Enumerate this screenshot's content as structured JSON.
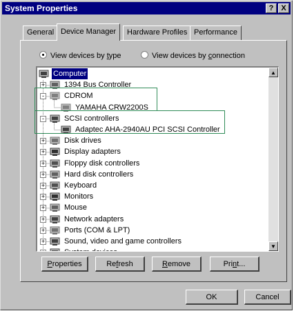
{
  "window": {
    "title": "System Properties",
    "help_btn": "?",
    "close_btn": "X"
  },
  "tabs": [
    {
      "label": "General"
    },
    {
      "label": "Device Manager"
    },
    {
      "label": "Hardware Profiles"
    },
    {
      "label": "Performance"
    }
  ],
  "view": {
    "by_type": {
      "pre": "View devices by ",
      "key": "t",
      "post": "ype"
    },
    "by_connection": {
      "pre": "View devices by ",
      "key": "c",
      "post": "onnection"
    }
  },
  "tree": [
    {
      "label": "Computer",
      "selected": true,
      "expander": "",
      "icon": "computer-icon"
    },
    {
      "label": "1394 Bus Controller",
      "expander": "+",
      "icon": "bus-controller-icon"
    },
    {
      "label": "CDROM",
      "expander": "-",
      "icon": "cdrom-icon"
    },
    {
      "label": "YAMAHA CRW2200S",
      "expander": "",
      "icon": "cdrom-icon"
    },
    {
      "label": "SCSI controllers",
      "expander": "-",
      "icon": "scsi-icon"
    },
    {
      "label": "Adaptec AHA-2940AU PCI SCSI Controller",
      "expander": "",
      "icon": "scsi-icon"
    },
    {
      "label": "Disk drives",
      "expander": "+",
      "icon": "disk-drive-icon"
    },
    {
      "label": "Display adapters",
      "expander": "+",
      "icon": "monitor-icon"
    },
    {
      "label": "Floppy disk controllers",
      "expander": "+",
      "icon": "floppy-icon"
    },
    {
      "label": "Hard disk controllers",
      "expander": "+",
      "icon": "hard-disk-icon"
    },
    {
      "label": "Keyboard",
      "expander": "+",
      "icon": "keyboard-icon"
    },
    {
      "label": "Monitors",
      "expander": "+",
      "icon": "monitor-icon"
    },
    {
      "label": "Mouse",
      "expander": "+",
      "icon": "mouse-icon"
    },
    {
      "label": "Network adapters",
      "expander": "+",
      "icon": "network-icon"
    },
    {
      "label": "Ports (COM & LPT)",
      "expander": "+",
      "icon": "port-icon"
    },
    {
      "label": "Sound, video and game controllers",
      "expander": "+",
      "icon": "sound-icon"
    },
    {
      "label": "System devices",
      "expander": "+",
      "icon": "computer-icon"
    }
  ],
  "buttons": {
    "properties": {
      "key": "P",
      "rest": "roperties"
    },
    "refresh": {
      "pre": "Re",
      "key": "f",
      "post": "resh"
    },
    "remove": {
      "key": "R",
      "rest": "emove"
    },
    "print": {
      "pre": "Pri",
      "key": "n",
      "post": "t..."
    },
    "ok": "OK",
    "cancel": "Cancel"
  },
  "colors": {
    "selection": "#000080",
    "highlight_box": "#2e8b57",
    "arrow": "#1e8040"
  }
}
